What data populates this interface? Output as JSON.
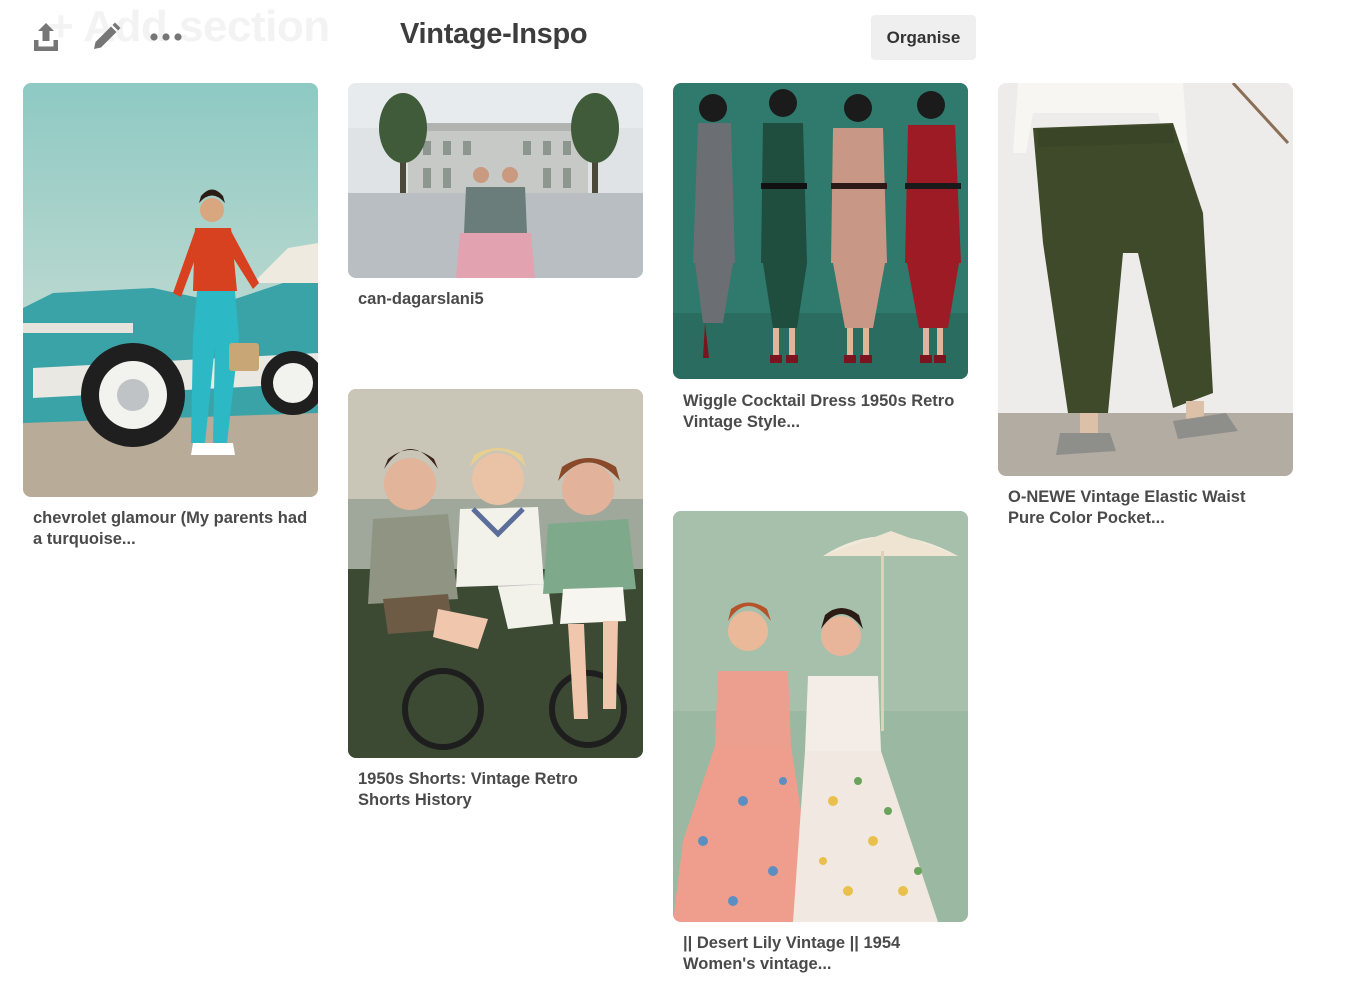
{
  "toolbar": {
    "ghost_heading": "+ Add section",
    "icons": {
      "share": "share-upload-icon",
      "edit": "pencil-icon",
      "more": "more-dots-icon"
    }
  },
  "board": {
    "title": "Vintage-Inspo",
    "organise_label": "Organise"
  },
  "pins": [
    {
      "caption": "chevrolet glamour (My parents had a turquoise...",
      "image": "woman in red top and turquoise capri pants leaning on vintage turquoise car"
    },
    {
      "caption": "can-dagarslani5",
      "image": "mirrored photo of woman in grey top and pink skirt in courtyard with trees"
    },
    {
      "caption": "1950s Shorts: Vintage Retro Shorts History",
      "image": "three smiling women in shorts riding bicycles"
    },
    {
      "caption": "Wiggle Cocktail Dress 1950s Retro Vintage Style...",
      "image": "four women in fitted wiggle dresses against teal backdrop"
    },
    {
      "caption": "|| Desert Lily Vintage || 1954 Women's vintage...",
      "image": "illustration of two women in floral dresses under a parasol"
    },
    {
      "caption": "O-NEWE Vintage Elastic Waist Pure Color Pocket...",
      "image": "olive green wide-leg trousers with white shirt and grey shoes"
    }
  ],
  "colors": {
    "button_bg": "#efefef",
    "title_text": "#3d3d3d",
    "caption_text": "#4a4a4a",
    "icon_grey": "#767676"
  }
}
